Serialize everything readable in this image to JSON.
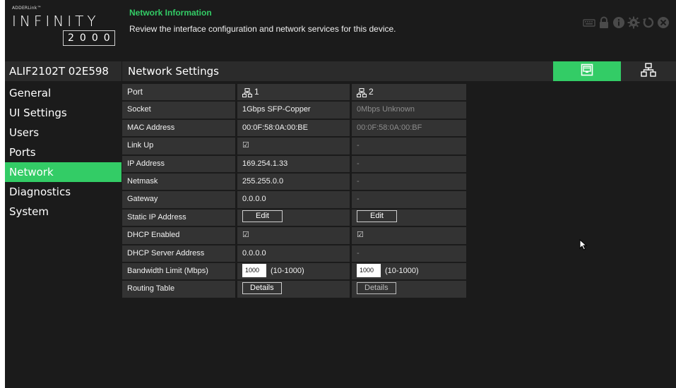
{
  "header": {
    "brand": "ADDERLink™",
    "product": "INFINITY",
    "model": "2000",
    "title": "Network Information",
    "description": "Review the interface configuration and network services for this device.",
    "icons": [
      "keyboard-icon",
      "lock-icon",
      "info-icon",
      "gear-icon",
      "refresh-icon",
      "close-icon"
    ]
  },
  "sidebar": {
    "device_name": "ALIF2102T 02E598",
    "items": [
      {
        "label": "General"
      },
      {
        "label": "UI Settings"
      },
      {
        "label": "Users"
      },
      {
        "label": "Ports"
      },
      {
        "label": "Network",
        "active": true
      },
      {
        "label": "Diagnostics"
      },
      {
        "label": "System"
      }
    ]
  },
  "panel": {
    "title": "Network Settings",
    "tabs": [
      "port-view-icon",
      "network-topology-icon"
    ]
  },
  "table": {
    "port_label": "Port",
    "port1": "1",
    "port2": "2",
    "rows": {
      "socket": {
        "label": "Socket",
        "p1": "1Gbps SFP-Copper",
        "p2": "0Mbps Unknown"
      },
      "mac": {
        "label": "MAC Address",
        "p1": "00:0F:58:0A:00:BE",
        "p2": "00:0F:58:0A:00:BF"
      },
      "link_up": {
        "label": "Link Up",
        "p1": "☑",
        "p2": "-"
      },
      "ip": {
        "label": "IP Address",
        "p1": "169.254.1.33",
        "p2": "-"
      },
      "netmask": {
        "label": "Netmask",
        "p1": "255.255.0.0",
        "p2": "-"
      },
      "gateway": {
        "label": "Gateway",
        "p1": "0.0.0.0",
        "p2": "-"
      },
      "static_ip": {
        "label": "Static IP Address",
        "p1": "Edit",
        "p2": "Edit"
      },
      "dhcp_enabled": {
        "label": "DHCP Enabled",
        "p1": "☑",
        "p2": "☑"
      },
      "dhcp_server": {
        "label": "DHCP Server Address",
        "p1": "0.0.0.0",
        "p2": "-"
      },
      "bandwidth": {
        "label": "Bandwidth Limit (Mbps)",
        "p1_value": "1000",
        "p2_value": "1000",
        "range": "(10-1000)"
      },
      "routing": {
        "label": "Routing Table",
        "p1": "Details",
        "p2": "Details"
      }
    }
  },
  "colors": {
    "accent": "#33cc66",
    "background": "#1b1b1b",
    "panel": "#2b2b2b",
    "cell": "#333333"
  }
}
